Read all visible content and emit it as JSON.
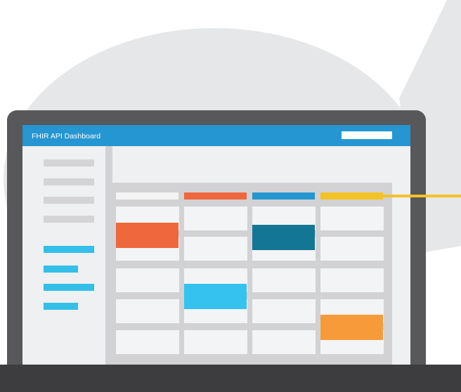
{
  "app": {
    "title": "FHIR API Dashboard"
  },
  "colors": {
    "header": "#2596d1",
    "bezel": "#58585a",
    "base": "#3d3d3f",
    "screen_bg": "#eef0f2",
    "gutter": "#d2d2d4",
    "sidebar_gray": "#d4d4d6",
    "sidebar_blue": "#33bfe8",
    "col_gray": "#f4f4f5",
    "col_orange": "#ef673c",
    "col_blue": "#2596d1",
    "col_yellow": "#f5c226",
    "event_orange": "#ef673c",
    "event_teal": "#137694",
    "event_cyan": "#35c2ee",
    "event_amber": "#f79b3a",
    "background_shape": "#e6e7e8"
  },
  "icons": {
    "search": "search-field"
  }
}
